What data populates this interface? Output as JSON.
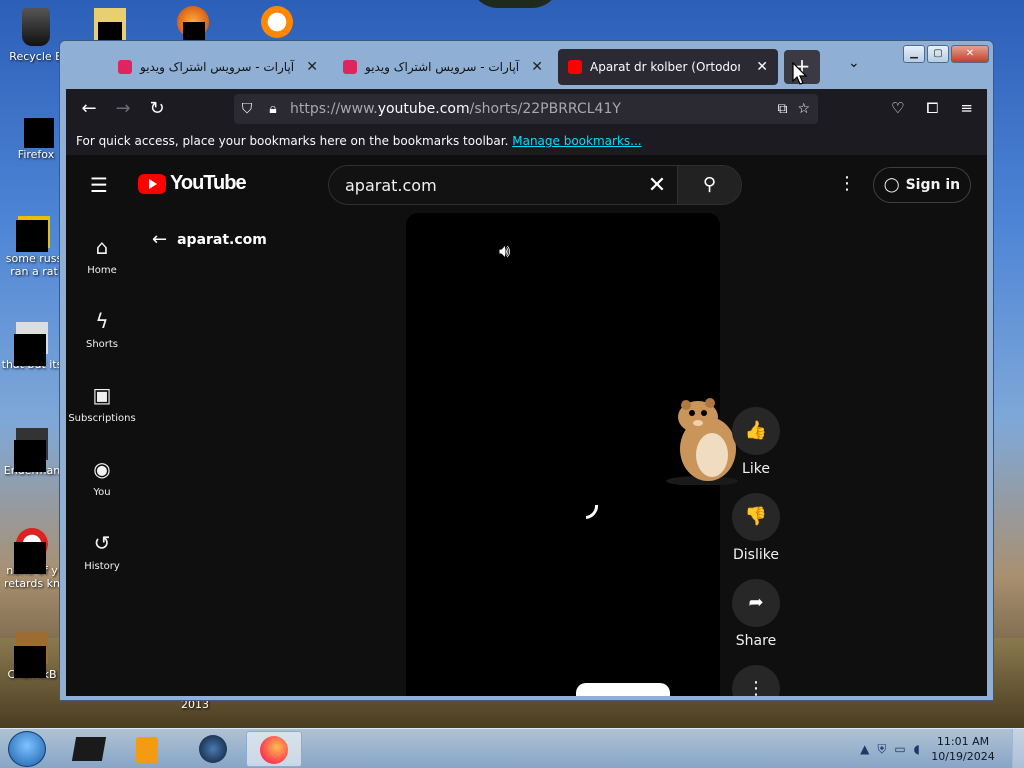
{
  "desktop": {
    "icons": [
      {
        "label": "Recycle B"
      },
      {
        "label": "Firefox"
      },
      {
        "label": "some russ\nran a rat"
      },
      {
        "label": "that but its"
      },
      {
        "label": "Enderman"
      },
      {
        "label": "none of y\nretards kn"
      },
      {
        "label": "ChomikB"
      }
    ],
    "year_label": "2013"
  },
  "browser": {
    "tabs": [
      {
        "title": "آپارات - سرویس اشتراک ویدیو",
        "close": "✕",
        "active": false
      },
      {
        "title": "آپارات - سرویس اشتراک ویدیو",
        "close": "✕",
        "active": false
      },
      {
        "title": "Aparat dr kolber (Ortodoncja) -",
        "close": "✕",
        "active": true
      }
    ],
    "new_tab": "+",
    "tab_list": "⌄",
    "url_prefix": "https://www.",
    "url_main": "youtube.com",
    "url_suffix": "/shorts/22PBRRCL41Y",
    "bookmarks_text": "For quick access, place your bookmarks here on the bookmarks toolbar.",
    "bookmarks_link": "Manage bookmarks..."
  },
  "youtube": {
    "logo": "YouTube",
    "search_value": "aparat.com",
    "sign_in": "Sign in",
    "back_label": "aparat.com",
    "sidebar": [
      {
        "label": "Home",
        "icon": "⌂"
      },
      {
        "label": "Shorts",
        "icon": "ϟ"
      },
      {
        "label": "Subscriptions",
        "icon": "▣"
      },
      {
        "label": "You",
        "icon": "◉"
      },
      {
        "label": "History",
        "icon": "↺"
      }
    ],
    "actions": [
      {
        "label": "Like",
        "icon": "👍"
      },
      {
        "label": "Dislike",
        "icon": "👎"
      },
      {
        "label": "Share",
        "icon": "➦"
      }
    ]
  },
  "taskbar": {
    "time": "11:01 AM",
    "date": "10/19/2024"
  },
  "colors": {
    "accent_red": "#ff0000",
    "firefox_dark": "#1c1b22",
    "link": "#00ddff"
  }
}
